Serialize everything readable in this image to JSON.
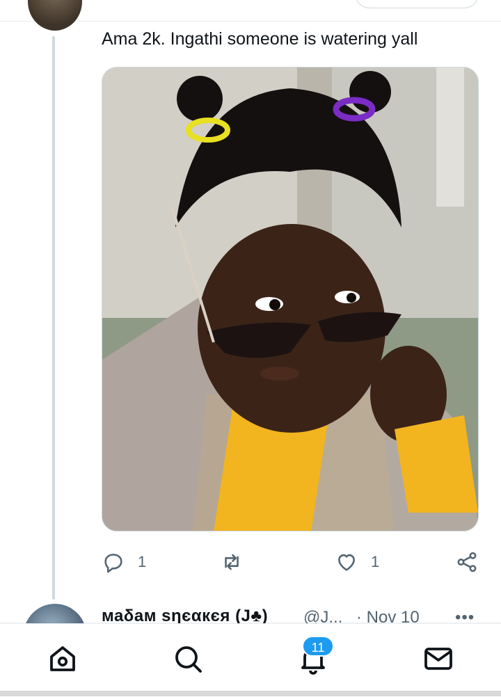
{
  "tweet": {
    "text": "Ama 2k. Ingathi someone is watering yall",
    "reply_count": "1",
    "like_count": "1"
  },
  "next_tweet": {
    "name": "маδам ѕηєαкєя (J♣)",
    "handle": "@J...",
    "date": "· Nov 10",
    "more": "•••"
  },
  "notifications_badge": "11",
  "colors": {
    "accent": "#1d9bf0",
    "muted": "#536471",
    "border": "#cfd9de"
  },
  "icons": [
    "reply-icon",
    "retweet-icon",
    "like-icon",
    "share-icon",
    "home-icon",
    "search-icon",
    "bell-icon",
    "mail-icon"
  ]
}
